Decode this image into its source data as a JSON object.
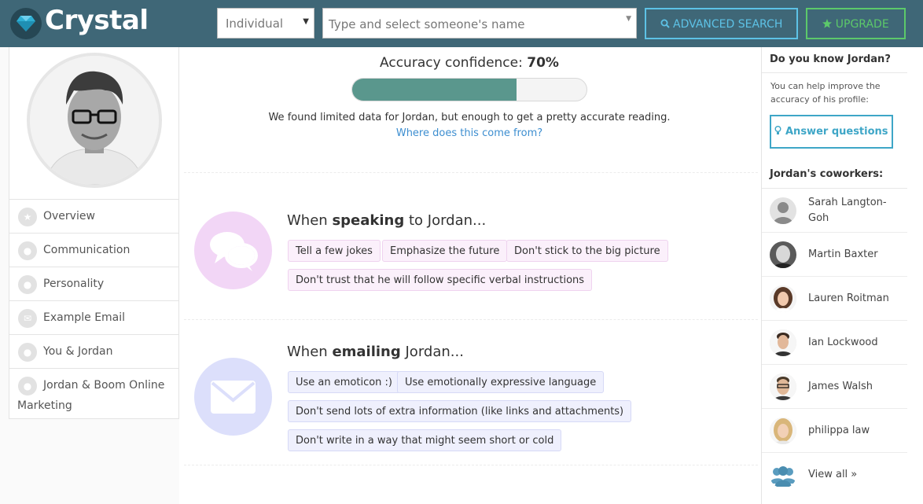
{
  "header": {
    "logo_text": "Crystal",
    "type_select": "Individual",
    "name_placeholder": "Type and select someone's name",
    "advanced_search": "ADVANCED SEARCH",
    "upgrade": "UPGRADE"
  },
  "nav": {
    "items": [
      {
        "label": "Overview",
        "icon": "star-icon"
      },
      {
        "label": "Communication",
        "icon": "chat-icon"
      },
      {
        "label": "Personality",
        "icon": "lightbulb-icon"
      },
      {
        "label": "Example Email",
        "icon": "envelope-icon"
      },
      {
        "label": "You & Jordan",
        "icon": "user-icon"
      },
      {
        "label": "Jordan & Boom Online Marketing",
        "icon": "shirt-icon"
      }
    ]
  },
  "confidence": {
    "label": "Accuracy confidence:",
    "value_text": "70%",
    "value": 0.7,
    "found_text": "We found limited data for Jordan, but enough to get a pretty accurate reading.",
    "where_link": "Where does this come from?"
  },
  "speaking": {
    "prefix": "When",
    "bold": "speaking",
    "suffix": "to Jordan...",
    "chips": [
      "Tell a few jokes",
      "Emphasize the future",
      "Don't stick to the big picture",
      "Don't trust that he will follow specific verbal instructions"
    ]
  },
  "emailing": {
    "prefix": "When",
    "bold": "emailing",
    "suffix": "Jordan...",
    "chips": [
      "Use an emoticon :)",
      "Use emotionally expressive language",
      "Don't send lots of extra information (like links and attachments)",
      "Don't write in a way that might seem short or cold"
    ]
  },
  "right": {
    "know_title": "Do you know Jordan?",
    "help_text": "You can help improve the accuracy of his profile:",
    "answer_button": "Answer questions",
    "coworkers_title": "Jordan's coworkers:",
    "coworkers": [
      "Sarah Langton-Goh",
      "Martin Baxter",
      "Lauren Roitman",
      "Ian Lockwood",
      "James Walsh",
      "philippa law"
    ],
    "view_all": "View all »"
  },
  "colors": {
    "header": "#3f6777",
    "accent_blue": "#5dc2e6",
    "accent_green": "#5cc96a",
    "bar_fill": "#5a978d",
    "speaking_circle": "#f2d6f6",
    "emailing_circle": "#dcdffb"
  }
}
